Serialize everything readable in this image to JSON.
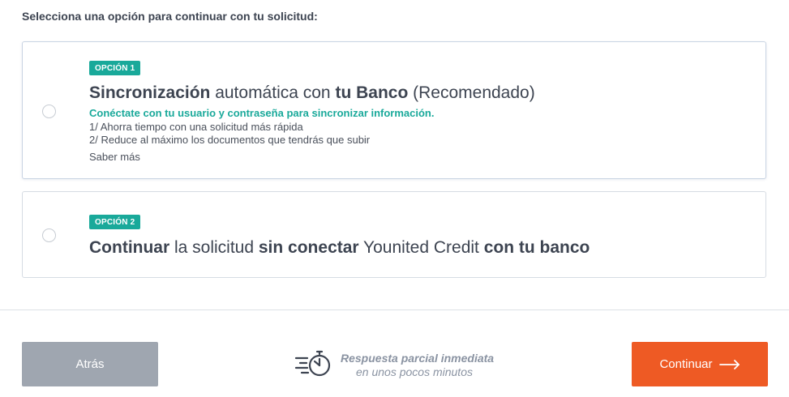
{
  "prompt": "Selecciona una opción para continuar con tu solicitud:",
  "option1": {
    "badge": "OPCIÓN 1",
    "title_parts": [
      "Sincronización",
      " automática con ",
      "tu Banco",
      " (Recomendado)"
    ],
    "subtitle": "Conéctate con tu usuario y contraseña para sincronizar información.",
    "benefits": [
      "1/ Ahorra tiempo con una solicitud más rápida",
      "2/ Reduce al máximo los documentos que tendrás que subir"
    ],
    "more_link": "Saber más"
  },
  "option2": {
    "badge": "OPCIÓN 2",
    "title_parts": [
      "Continuar",
      " la solicitud ",
      "sin conectar",
      " Younited Credit ",
      "con tu banco"
    ]
  },
  "footer": {
    "back_label": "Atrás",
    "response_line1": "Respuesta parcial inmediata",
    "response_line2": "en unos pocos minutos",
    "continue_label": "Continuar",
    "timer_icon": "stopwatch-speed-icon",
    "arrow_icon": "arrow-right-icon"
  },
  "colors": {
    "accent_teal": "#19a99a",
    "primary_orange": "#ee5a24",
    "back_gray": "#9fa6b0"
  }
}
